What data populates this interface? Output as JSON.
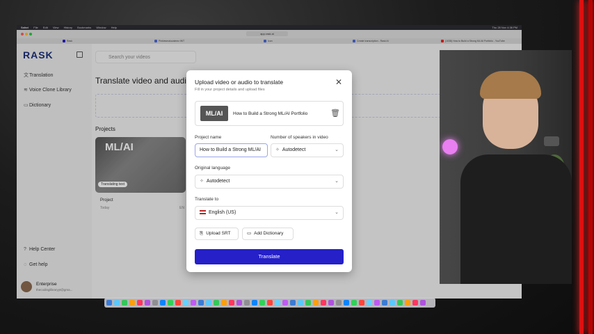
{
  "menubar": {
    "items": [
      "Safari",
      "File",
      "Edit",
      "View",
      "History",
      "Bookmarks",
      "Window",
      "Help"
    ],
    "clock": "Thu 28 Nov 4:38 PM"
  },
  "browser": {
    "url": "app.rask.ai",
    "tabs": [
      "Rask",
      "Pinkiesmaluzalmez WiT",
      "Icon",
      "Create transcription - Rask AI",
      "(1038) How to Build a Strong ML/AI Portfolio - YouTube"
    ]
  },
  "sidebar": {
    "logo": "RASK",
    "nav": [
      {
        "label": "Translation",
        "icon": "translate-icon"
      },
      {
        "label": "Voice Clone Library",
        "icon": "voice-icon"
      },
      {
        "label": "Dictionary",
        "icon": "book-icon"
      }
    ],
    "bottom": [
      {
        "label": "Help Center",
        "icon": "help-icon"
      },
      {
        "label": "Get help",
        "icon": "chat-icon"
      }
    ],
    "profile": {
      "plan": "Enterprise",
      "email": "thecodinglibraryyt@gma..."
    }
  },
  "main": {
    "search_placeholder": "Search your videos",
    "title": "Translate video and audio",
    "projects_heading": "Projects",
    "project": {
      "name": "Project",
      "date": "Today",
      "status": "Translating text",
      "thumb_text": "ML/AI",
      "lang_code": "EN"
    }
  },
  "modal": {
    "title": "Upload video or audio to translate",
    "subtitle": "Fill in your project details and upload files",
    "file": {
      "thumb_text": "ML/AI",
      "name": "How to Build a Strong ML/AI Portfolio"
    },
    "project_name_label": "Project name",
    "project_name_value": "How to Build a Strong ML/AI",
    "speakers_label": "Number of speakers in video",
    "speakers_value": "Autodetect",
    "orig_lang_label": "Original language",
    "orig_lang_value": "Autodetect",
    "translate_to_label": "Translate to",
    "translate_to_value": "English (US)",
    "upload_srt": "Upload SRT",
    "add_dictionary": "Add Dictionary",
    "translate_button": "Translate"
  },
  "colors": {
    "primary": "#2520c8",
    "logo": "#1b2f7a",
    "lamp": "#e97ff0",
    "neon": "#dd1111"
  }
}
